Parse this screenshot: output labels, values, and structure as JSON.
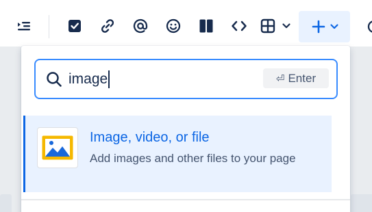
{
  "toolbar": {
    "buttons": [
      {
        "name": "indent-icon",
        "label": "Indent"
      },
      {
        "name": "checkbox-icon",
        "label": "Action item"
      },
      {
        "name": "link-icon",
        "label": "Link"
      },
      {
        "name": "mention-icon",
        "label": "Mention"
      },
      {
        "name": "emoji-icon",
        "label": "Emoji"
      },
      {
        "name": "layout-icon",
        "label": "Layouts"
      },
      {
        "name": "code-icon",
        "label": "Code snippet"
      },
      {
        "name": "table-icon",
        "label": "Table"
      },
      {
        "name": "chevron-down-icon",
        "label": "Table options"
      },
      {
        "name": "plus-icon",
        "label": "Insert"
      }
    ],
    "insert_active_color": "#0c66e4"
  },
  "search": {
    "value": "image",
    "placeholder": "",
    "enter_hint": "Enter",
    "focus_color": "#388bff"
  },
  "results": [
    {
      "icon": "image-icon",
      "title": "Image, video, or file",
      "description": "Add images and other files to your page",
      "selected": true
    }
  ],
  "colors": {
    "accent": "#0c66e4",
    "selected_bg": "#e9f2ff",
    "text": "#172b4d",
    "subtle_text": "#44546f"
  }
}
